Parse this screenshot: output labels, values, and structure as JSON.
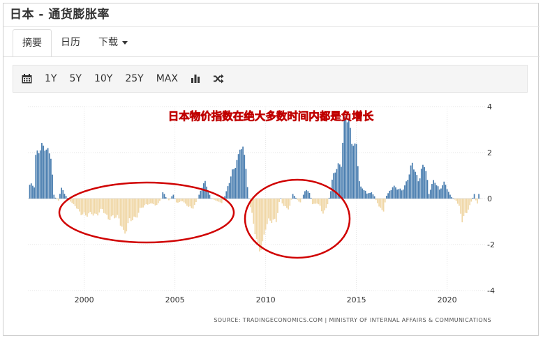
{
  "header": {
    "title": "日本 - 通货膨胀率"
  },
  "tabs": [
    {
      "label": "摘要",
      "active": true
    },
    {
      "label": "日历",
      "active": false
    },
    {
      "label": "下载",
      "active": false
    }
  ],
  "toolbar": {
    "calendar_icon": "calendar-icon",
    "ranges": [
      "1Y",
      "5Y",
      "10Y",
      "25Y",
      "MAX"
    ],
    "chart_type_icon": "bar-chart-icon",
    "compare_icon": "shuffle-icon"
  },
  "annotation": "日本物价指数在绝大多数时间内都是负增长",
  "source": "SOURCE: TRADINGECONOMICS.COM  |  MINISTRY OF INTERNAL AFFAIRS & COMMUNICATIONS",
  "colors": {
    "positive": "#4a7eb0",
    "negative": "#f0d7a6",
    "circle": "#d00000",
    "annotation_text": "#ffff00",
    "annotation_outline": "#c00000"
  },
  "chart_data": {
    "type": "bar",
    "title": "",
    "xlabel": "",
    "ylabel": "",
    "ylim": [
      -4,
      4
    ],
    "y_ticks": [
      "4",
      "2",
      "0",
      "-2",
      "-4"
    ],
    "x_ticks": [
      "2000",
      "2005",
      "2010",
      "2015",
      "2020"
    ],
    "x_range": [
      1996.9,
      2021.9
    ],
    "grid": true,
    "series": [
      {
        "frequency": "monthly",
        "x": [
          1997.0,
          2021.75
        ],
        "anchors": [
          [
            1997.0,
            0.6
          ],
          [
            1997.25,
            0.5
          ],
          [
            1997.34,
            1.9
          ],
          [
            1997.5,
            2.1
          ],
          [
            1997.67,
            2.4
          ],
          [
            1997.83,
            2.2
          ],
          [
            1998.0,
            2.0
          ],
          [
            1998.17,
            1.8
          ],
          [
            1998.34,
            0.1
          ],
          [
            1998.58,
            -0.1
          ],
          [
            1998.75,
            0.5
          ],
          [
            1998.92,
            0.2
          ],
          [
            1999.2,
            -0.1
          ],
          [
            1999.5,
            -0.3
          ],
          [
            1999.8,
            -0.6
          ],
          [
            2000.1,
            -0.8
          ],
          [
            2000.4,
            -0.6
          ],
          [
            2000.7,
            -0.7
          ],
          [
            2001.0,
            -0.5
          ],
          [
            2001.3,
            -0.8
          ],
          [
            2001.6,
            -0.8
          ],
          [
            2001.9,
            -0.9
          ],
          [
            2002.1,
            -1.2
          ],
          [
            2002.2,
            -1.5
          ],
          [
            2002.5,
            -1.0
          ],
          [
            2002.8,
            -0.9
          ],
          [
            2003.1,
            -0.4
          ],
          [
            2003.4,
            -0.3
          ],
          [
            2003.7,
            -0.2
          ],
          [
            2004.0,
            -0.3
          ],
          [
            2004.25,
            0.0
          ],
          [
            2004.35,
            0.4
          ],
          [
            2004.45,
            0.1
          ],
          [
            2004.7,
            -0.1
          ],
          [
            2004.9,
            0.2
          ],
          [
            2005.1,
            -0.2
          ],
          [
            2005.4,
            -0.1
          ],
          [
            2005.7,
            -0.3
          ],
          [
            2005.95,
            -0.5
          ],
          [
            2006.2,
            -0.1
          ],
          [
            2006.35,
            0.2
          ],
          [
            2006.5,
            0.5
          ],
          [
            2006.7,
            0.8
          ],
          [
            2006.85,
            0.3
          ],
          [
            2007.0,
            0.0
          ],
          [
            2007.3,
            -0.1
          ],
          [
            2007.6,
            -0.2
          ],
          [
            2007.8,
            0.2
          ],
          [
            2008.0,
            0.7
          ],
          [
            2008.2,
            1.2
          ],
          [
            2008.5,
            1.9
          ],
          [
            2008.6,
            2.3
          ],
          [
            2008.75,
            2.1
          ],
          [
            2008.9,
            1.5
          ],
          [
            2009.0,
            0.5
          ],
          [
            2009.1,
            -0.1
          ],
          [
            2009.3,
            -1.0
          ],
          [
            2009.5,
            -1.8
          ],
          [
            2009.7,
            -2.2
          ],
          [
            2009.85,
            -1.9
          ],
          [
            2010.0,
            -1.3
          ],
          [
            2010.2,
            -1.0
          ],
          [
            2010.4,
            -0.9
          ],
          [
            2010.6,
            -0.9
          ],
          [
            2010.8,
            0.1
          ],
          [
            2010.95,
            -0.3
          ],
          [
            2011.1,
            -0.4
          ],
          [
            2011.3,
            -0.4
          ],
          [
            2011.5,
            0.2
          ],
          [
            2011.7,
            0.0
          ],
          [
            2011.9,
            -0.2
          ],
          [
            2012.1,
            0.2
          ],
          [
            2012.3,
            0.4
          ],
          [
            2012.45,
            0.2
          ],
          [
            2012.6,
            -0.3
          ],
          [
            2012.8,
            -0.2
          ],
          [
            2013.0,
            -0.3
          ],
          [
            2013.2,
            -0.7
          ],
          [
            2013.4,
            -0.3
          ],
          [
            2013.55,
            0.2
          ],
          [
            2013.65,
            0.7
          ],
          [
            2013.8,
            1.1
          ],
          [
            2014.0,
            1.4
          ],
          [
            2014.2,
            1.6
          ],
          [
            2014.3,
            3.4
          ],
          [
            2014.4,
            3.7
          ],
          [
            2014.5,
            3.4
          ],
          [
            2014.6,
            3.3
          ],
          [
            2014.75,
            2.4
          ],
          [
            2014.9,
            2.3
          ],
          [
            2015.0,
            2.4
          ],
          [
            2015.2,
            0.5
          ],
          [
            2015.4,
            0.4
          ],
          [
            2015.6,
            0.2
          ],
          [
            2015.8,
            0.3
          ],
          [
            2016.0,
            0.1
          ],
          [
            2016.1,
            -0.1
          ],
          [
            2016.3,
            -0.4
          ],
          [
            2016.5,
            -0.5
          ],
          [
            2016.65,
            0.1
          ],
          [
            2016.8,
            0.3
          ],
          [
            2017.0,
            0.5
          ],
          [
            2017.3,
            0.4
          ],
          [
            2017.5,
            0.4
          ],
          [
            2017.7,
            0.6
          ],
          [
            2017.9,
            1.0
          ],
          [
            2018.1,
            1.5
          ],
          [
            2018.25,
            1.2
          ],
          [
            2018.4,
            0.8
          ],
          [
            2018.6,
            1.3
          ],
          [
            2018.8,
            1.4
          ],
          [
            2019.0,
            0.2
          ],
          [
            2019.2,
            0.8
          ],
          [
            2019.4,
            0.7
          ],
          [
            2019.6,
            0.3
          ],
          [
            2019.8,
            0.7
          ],
          [
            2020.0,
            0.5
          ],
          [
            2020.2,
            0.1
          ],
          [
            2020.35,
            0.0
          ],
          [
            2020.5,
            -0.1
          ],
          [
            2020.7,
            -0.4
          ],
          [
            2020.85,
            -1.1
          ],
          [
            2021.0,
            -0.7
          ],
          [
            2021.2,
            -0.4
          ],
          [
            2021.35,
            -0.1
          ],
          [
            2021.5,
            0.2
          ],
          [
            2021.65,
            -0.3
          ],
          [
            2021.75,
            0.2
          ]
        ]
      }
    ]
  }
}
